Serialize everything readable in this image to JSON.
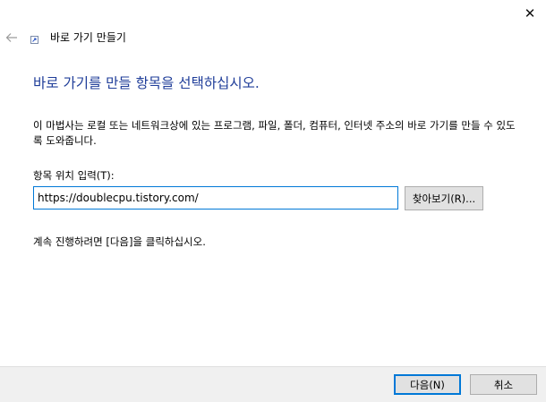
{
  "window": {
    "title": "바로 가기 만들기",
    "close_glyph": "✕"
  },
  "wizard": {
    "heading": "바로 가기를 만들 항목을 선택하십시오.",
    "description": "이 마법사는 로컬 또는 네트워크상에 있는 프로그램, 파일, 폴더, 컴퓨터, 인터넷 주소의 바로 가기를 만들 수 있도록 도와줍니다.",
    "location_label": "항목 위치 입력(T):",
    "location_value": "https://doublecpu.tistory.com/",
    "browse_label": "찾아보기(R)...",
    "instruction": "계속 진행하려면 [다음]을 클릭하십시오."
  },
  "footer": {
    "next_label": "다음(N)",
    "cancel_label": "취소"
  },
  "colors": {
    "heading": "#1f3d99",
    "accent": "#0078d7",
    "footer_bg": "#f0f0f0"
  }
}
